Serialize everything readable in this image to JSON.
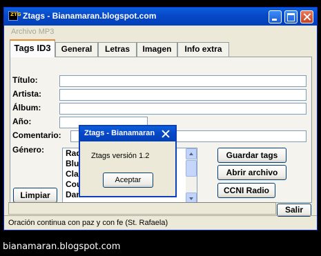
{
  "window": {
    "title": "Ztags - Bianamaran.blogspot.com",
    "icon_label": "ZTG"
  },
  "menu": {
    "archivo": "Archivo MP3"
  },
  "tabs": [
    {
      "label": "Tags ID3",
      "active": true
    },
    {
      "label": "General",
      "active": false
    },
    {
      "label": "Letras",
      "active": false
    },
    {
      "label": "Imagen",
      "active": false
    },
    {
      "label": "Info extra",
      "active": false
    }
  ],
  "form": {
    "titulo_label": "Título:",
    "artista_label": "Artista:",
    "album_label": "Álbum:",
    "anio_label": "Año:",
    "comentario_label": "Comentario:",
    "genero_label": "Género:",
    "titulo_value": "",
    "artista_value": "",
    "album_value": "",
    "anio_value": "",
    "comentario_value": ""
  },
  "genres": [
    "Rad",
    "Blue",
    "Clas",
    "Cou",
    "Dan"
  ],
  "buttons": {
    "limpiar": "Limpiar",
    "guardar": "Guardar tags",
    "abrir": "Abrir archivo",
    "radio": "CCNI Radio",
    "salir": "Salir"
  },
  "status": "Oración continua con paz y con fe (St. Rafaela)",
  "dialog": {
    "title": "Ztags - Bianamaran",
    "message": "Ztags versión 1.2",
    "ok": "Aceptar"
  },
  "caption": "bianamaran.blogspot.com",
  "colors": {
    "titlebar": "#0848c8",
    "tab_accent": "#e68b2c",
    "face": "#ece9d8"
  }
}
